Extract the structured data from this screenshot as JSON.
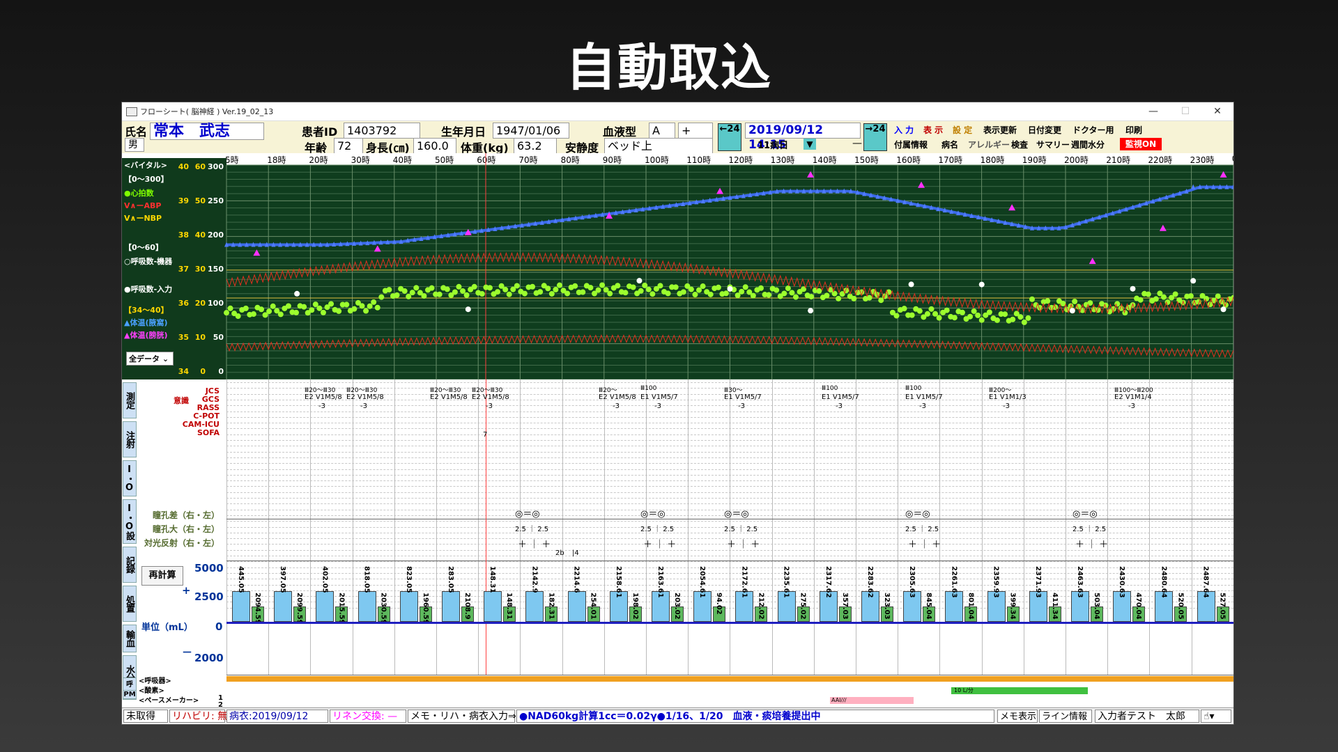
{
  "slide_title": "自動取込",
  "window": {
    "title": "フローシート( 脳神経 ) Ver.19_02_13",
    "minimize": "—",
    "maximize": "☐",
    "close": "✕"
  },
  "patient": {
    "name_label": "氏名",
    "name": "常本　武志",
    "sex": "男",
    "id_label": "患者ID",
    "id": "1403792",
    "dob_label": "生年月日",
    "dob": "1947/01/06",
    "blood_label": "血液型",
    "blood_type": "A",
    "rh": "+",
    "age_label": "年齢",
    "age": "72",
    "height_label": "身長(㎝)",
    "height": "160.0",
    "weight_label": "体重(kg)",
    "weight": "63.2",
    "rest_label": "安静度",
    "rest": "ベッド上"
  },
  "datetime": {
    "prev": "←24",
    "next": "→24",
    "current": "2019/09/12 14:15",
    "ward_day": "11病日",
    "dash": "—"
  },
  "menu_top": [
    {
      "label": "入 力",
      "color": "#0000ff"
    },
    {
      "label": "表 示",
      "color": "#c00000"
    },
    {
      "label": "設 定",
      "color": "#c08000"
    },
    {
      "label": "表示更新",
      "color": "#000000"
    },
    {
      "label": "日付変更",
      "color": "#000000"
    },
    {
      "label": "ドクター用",
      "color": "#000000"
    },
    {
      "label": "印刷",
      "color": "#000000"
    }
  ],
  "menu_bottom": [
    {
      "label": "付属情報"
    },
    {
      "label": "病名"
    },
    {
      "label": "アレルギー"
    },
    {
      "label": "検査"
    },
    {
      "label": "サマリー"
    },
    {
      "label": "週間水分"
    }
  ],
  "monitor_button": "監視ON",
  "hours": [
    "5時",
    "18時",
    "20時",
    "30時",
    "40時",
    "50時",
    "60時",
    "70時",
    "80時",
    "90時",
    "100時",
    "110時",
    "120時",
    "130時",
    "140時",
    "150時",
    "160時",
    "170時",
    "180時",
    "190時",
    "200時",
    "210時",
    "220時",
    "230時",
    "0E"
  ],
  "vital_panel": {
    "header": "<バイタル>",
    "range1": "【0～300】",
    "hr": "●心拍数",
    "abp": "V∧ーABP",
    "nbp": "V∧ーNBP",
    "range2": "【0～60】",
    "resp_monitor": "○呼吸数-機器",
    "resp_input": "●呼吸数-入力",
    "range3": "【34～40】",
    "temp1": "▲体温(腋窩)",
    "temp2": "▲体温(膀胱)",
    "filter": "全データ",
    "axis_temp": [
      "40",
      "39",
      "38",
      "37",
      "36",
      "35",
      "34"
    ],
    "axis_resp": [
      "60",
      "50",
      "40",
      "30",
      "20",
      "10",
      "0"
    ],
    "axis_main": [
      "300",
      "250",
      "200",
      "150",
      "100",
      "50",
      "0"
    ]
  },
  "tabs": [
    "測定",
    "注射",
    "I・O",
    "I・O設定",
    "記録",
    "処置",
    "輸血",
    "水分"
  ],
  "neuro_labels": [
    "JCS",
    "GCS",
    "RASS",
    "C-POT",
    "CAM-ICU",
    "SOFA"
  ],
  "neuro_group_label": "意識",
  "pupil_labels": [
    "瞳孔差（右・左）",
    "瞳孔大（右・左）",
    "対光反射（右・左）"
  ],
  "neuro_cols": [
    {
      "jcs": "Ⅲ20～Ⅲ30",
      "gcs": "E2 V1M5/8",
      "rass": "-3"
    },
    {
      "jcs": "Ⅲ20～Ⅲ30",
      "gcs": "E2 V1M5/8",
      "rass": "-3"
    },
    {
      "jcs": "Ⅲ20～Ⅲ30",
      "gcs": "E2 V1M5/8",
      "rass": ""
    },
    {
      "jcs": "Ⅲ20～Ⅲ30",
      "gcs": "E2 V1M5/8",
      "rass": "-3"
    },
    {
      "jcs": "Ⅲ20～",
      "gcs": "E2 V1M5/8",
      "rass": "-3"
    },
    {
      "jcs": "Ⅲ100",
      "gcs": "E1 V1M5/7",
      "rass": "-3"
    },
    {
      "jcs": "Ⅲ30～",
      "gcs": "E1 V1M5/7",
      "rass": "-3"
    },
    {
      "jcs": "Ⅲ100",
      "gcs": "E1 V1M5/7",
      "rass": "-3"
    },
    {
      "jcs": "Ⅲ100",
      "gcs": "E1 V1M5/7",
      "rass": "-3"
    },
    {
      "jcs": "Ⅲ200～",
      "gcs": "E1 V1M1/3",
      "rass": "-3"
    },
    {
      "jcs": "Ⅲ100～Ⅲ200",
      "gcs": "E2 V1M1/4",
      "rass": "-3"
    }
  ],
  "sofa_value": "7",
  "pupil": {
    "diff": "◎＝◎",
    "size": "2.5 ｜ 2.5",
    "reflex": "＋ ｜ ＋"
  },
  "pupil_extra": [
    "2b",
    "|4"
  ],
  "fluid": {
    "recalc_button": "再計算",
    "axis": [
      "5000",
      "+",
      "2500",
      "0",
      "－",
      "2000"
    ],
    "unit_label": "単位（mL）",
    "values": [
      "445.05",
      "2094.59",
      "397.05",
      "2099.59",
      "402.05",
      "2015.59",
      "818.05",
      "2030.59",
      "823.05",
      "1960.59",
      "283.05",
      "2108.9",
      "148.31",
      "148.31",
      "2142.9",
      "182.31",
      "2214.6",
      "254.01",
      "2158.61",
      "198.02",
      "2163.61",
      "203.02",
      "2054.61",
      "94.02",
      "2172.61",
      "212.02",
      "2235.61",
      "275.02",
      "2317.62",
      "357.03",
      "2283.62",
      "323.03",
      "2305.63",
      "845.04",
      "2261.63",
      "801.04",
      "2359.93",
      "399.34",
      "2371.93",
      "411.34",
      "2463.63",
      "503.04",
      "2430.63",
      "470.04",
      "2480.64",
      "520.05",
      "2487.64",
      "527.05",
      "2487.64"
    ]
  },
  "bottom_rows": [
    "<呼吸器>",
    "<酸素>",
    "<ペースメーカー>"
  ],
  "bottom_tabs": [
    "呼吸",
    "PM"
  ],
  "o2_label": "10 L/分",
  "aai_label": "AAI///",
  "status": {
    "untaken": "未取得",
    "rehab": "リハビリ: 無",
    "gown": "病衣:2019/09/12",
    "linen": "リネン交換: —",
    "memo_entry": "メモ・リハ・病衣入力⇒",
    "memo": "●NAD60kg計算1cc＝0.02γ●1/16、1/20　血液・痰培養提出中",
    "memo_view": "メモ表示",
    "line_info": "ライン情報",
    "user": "入力者テスト　太郎"
  }
}
